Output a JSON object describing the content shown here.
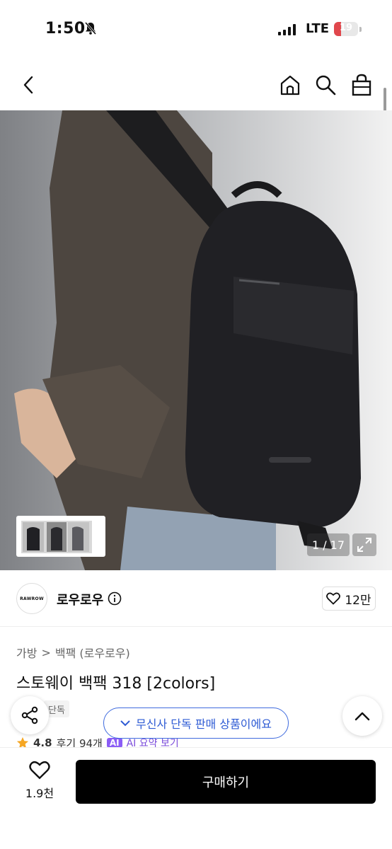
{
  "status_bar": {
    "time": "1:50",
    "network": "LTE",
    "battery": "19"
  },
  "icons": {
    "back": "chevron-left-icon",
    "home": "home-icon",
    "search": "search-icon",
    "cart": "shopping-bag-icon",
    "expand": "expand-icon",
    "info": "info-icon",
    "heart": "heart-icon",
    "share": "share-icon",
    "chevron_down": "chevron-down-icon",
    "chevron_up": "chevron-up-icon",
    "star": "star-icon"
  },
  "gallery": {
    "counter": "1 / 17"
  },
  "brand": {
    "logo_text": "RAWROW",
    "name": "로우로우",
    "likes": "12만"
  },
  "breadcrumb": {
    "category": "가방",
    "separator": ">",
    "subcategory": "백팩 (로우로우)"
  },
  "product": {
    "title": "스토웨이 백팩 318 [2colors]",
    "tag": "단독"
  },
  "exclusive_banner": {
    "label": "무신사 단독 판매 상품이에요"
  },
  "rating": {
    "score": "4.8",
    "reviews": "후기 94개",
    "ai_badge": "AI",
    "ai_link": "AI 요약 보기"
  },
  "bottom_bar": {
    "wish_count": "1.9천",
    "buy_label": "구매하기"
  },
  "colors": {
    "accent_blue": "#3f6bde",
    "battery_red": "#e0474c",
    "ai_purple": "#8b5cf6",
    "star": "#f5a623"
  }
}
